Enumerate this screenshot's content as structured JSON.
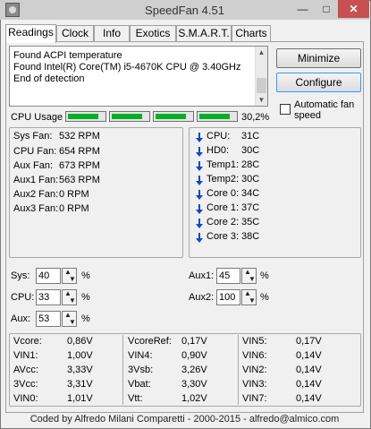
{
  "window": {
    "title": "SpeedFan 4.51",
    "minimize_glyph": "—",
    "maximize_glyph": "□",
    "close_glyph": "✕"
  },
  "tabs": [
    {
      "label": "Readings",
      "active": true
    },
    {
      "label": "Clock",
      "active": false
    },
    {
      "label": "Info",
      "active": false
    },
    {
      "label": "Exotics",
      "active": false
    },
    {
      "label": "S.M.A.R.T.",
      "active": false
    },
    {
      "label": "Charts",
      "active": false
    }
  ],
  "log": [
    "Found ACPI temperature",
    "Found Intel(R) Core(TM) i5-4670K CPU @ 3.40GHz",
    "End of detection"
  ],
  "buttons": {
    "minimize": "Minimize",
    "configure": "Configure"
  },
  "auto_fan_speed": {
    "label": "Automatic fan speed",
    "checked": false
  },
  "cpu_usage": {
    "label": "CPU Usage",
    "percent_text": "30,2%",
    "core_levels": [
      0.85,
      0.85,
      0.85,
      0.85
    ],
    "bar_color": "#06b025"
  },
  "fans": [
    {
      "label": "Sys Fan:",
      "value": "532 RPM"
    },
    {
      "label": "CPU Fan:",
      "value": "654 RPM"
    },
    {
      "label": "Aux Fan:",
      "value": "673 RPM"
    },
    {
      "label": "Aux1 Fan:",
      "value": "563 RPM"
    },
    {
      "label": "Aux2 Fan:",
      "value": "0 RPM"
    },
    {
      "label": "Aux3 Fan:",
      "value": "0 RPM"
    }
  ],
  "temps": [
    {
      "label": "CPU:",
      "value": "31C",
      "trend": "down"
    },
    {
      "label": "HD0:",
      "value": "30C",
      "trend": "down"
    },
    {
      "label": "Temp1:",
      "value": "28C",
      "trend": "down"
    },
    {
      "label": "Temp2:",
      "value": "30C",
      "trend": "down"
    },
    {
      "label": "Core 0:",
      "value": "34C",
      "trend": "down"
    },
    {
      "label": "Core 1:",
      "value": "37C",
      "trend": "down"
    },
    {
      "label": "Core 2:",
      "value": "35C",
      "trend": "down"
    },
    {
      "label": "Core 3:",
      "value": "38C",
      "trend": "down"
    }
  ],
  "speeds": {
    "sys": {
      "label": "Sys:",
      "value": "40",
      "unit": "%"
    },
    "cpu": {
      "label": "CPU:",
      "value": "33",
      "unit": "%"
    },
    "aux": {
      "label": "Aux:",
      "value": "53",
      "unit": "%"
    },
    "aux1": {
      "label": "Aux1:",
      "value": "45",
      "unit": "%"
    },
    "aux2": {
      "label": "Aux2:",
      "value": "100",
      "unit": "%"
    }
  },
  "voltages": {
    "col1": [
      {
        "label": "Vcore:",
        "value": "0,86V"
      },
      {
        "label": "VIN1:",
        "value": "1,00V"
      },
      {
        "label": "AVcc:",
        "value": "3,33V"
      },
      {
        "label": "3Vcc:",
        "value": "3,31V"
      },
      {
        "label": "VIN0:",
        "value": "1,01V"
      }
    ],
    "col2": [
      {
        "label": "VcoreRef:",
        "value": "0,17V"
      },
      {
        "label": "VIN4:",
        "value": "0,90V"
      },
      {
        "label": "3Vsb:",
        "value": "3,26V"
      },
      {
        "label": "Vbat:",
        "value": "3,30V"
      },
      {
        "label": "Vtt:",
        "value": "1,02V"
      }
    ],
    "col3": [
      {
        "label": "VIN5:",
        "value": "0,17V"
      },
      {
        "label": "VIN6:",
        "value": "0,14V"
      },
      {
        "label": "VIN2:",
        "value": "0,14V"
      },
      {
        "label": "VIN3:",
        "value": "0,14V"
      },
      {
        "label": "VIN7:",
        "value": "0,14V"
      }
    ]
  },
  "status": "Coded by Alfredo Milani Comparetti - 2000-2015 - alfredo@almico.com"
}
